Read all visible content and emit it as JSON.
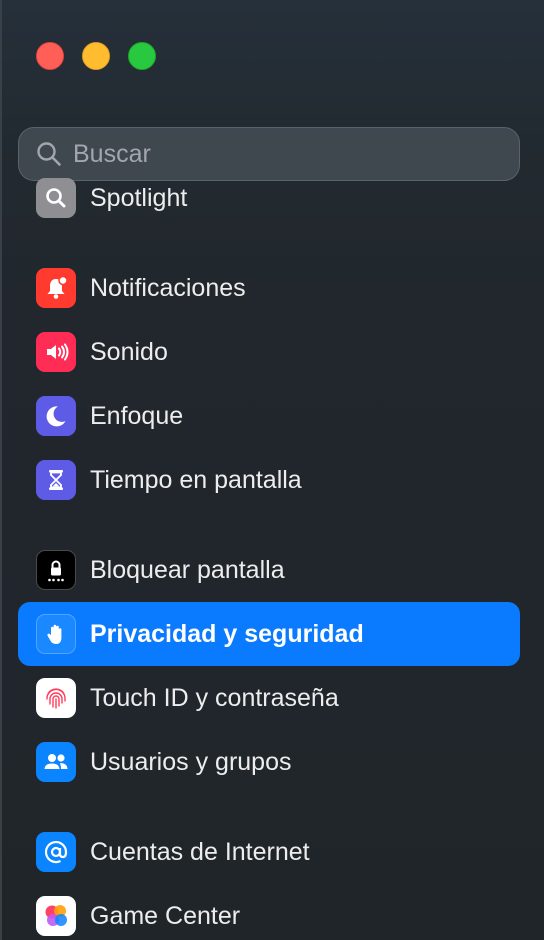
{
  "window": {
    "traffic_lights": [
      "close",
      "minimize",
      "zoom"
    ]
  },
  "search": {
    "placeholder": "Buscar",
    "icon": "search-icon"
  },
  "sidebar": {
    "selected_color": "#0a7aff",
    "items": [
      {
        "label": "Spotlight",
        "icon": "spotlight-icon",
        "color": "#8e8e93",
        "selected": false
      },
      {
        "label": "Notificaciones",
        "icon": "notifications-icon",
        "color": "#ff3b30",
        "selected": false
      },
      {
        "label": "Sonido",
        "icon": "sound-icon",
        "color": "#ff2d55",
        "selected": false
      },
      {
        "label": "Enfoque",
        "icon": "focus-moon-icon",
        "color": "#5e5ce6",
        "selected": false
      },
      {
        "label": "Tiempo en pantalla",
        "icon": "screen-time-hourglass-icon",
        "color": "#5e5ce6",
        "selected": false
      },
      {
        "label": "Bloquear pantalla",
        "icon": "lock-screen-icon",
        "color": "#000000",
        "selected": false
      },
      {
        "label": "Privacidad y seguridad",
        "icon": "privacy-hand-icon",
        "color": "#0a84ff",
        "selected": true
      },
      {
        "label": "Touch ID y contraseña",
        "icon": "fingerprint-icon",
        "color": "#ffffff",
        "selected": false
      },
      {
        "label": "Usuarios y grupos",
        "icon": "users-groups-icon",
        "color": "#0a84ff",
        "selected": false
      },
      {
        "label": "Cuentas de Internet",
        "icon": "internet-accounts-at-icon",
        "color": "#0a84ff",
        "selected": false
      },
      {
        "label": "Game Center",
        "icon": "game-center-icon",
        "color": "#ffffff",
        "selected": false
      }
    ]
  }
}
